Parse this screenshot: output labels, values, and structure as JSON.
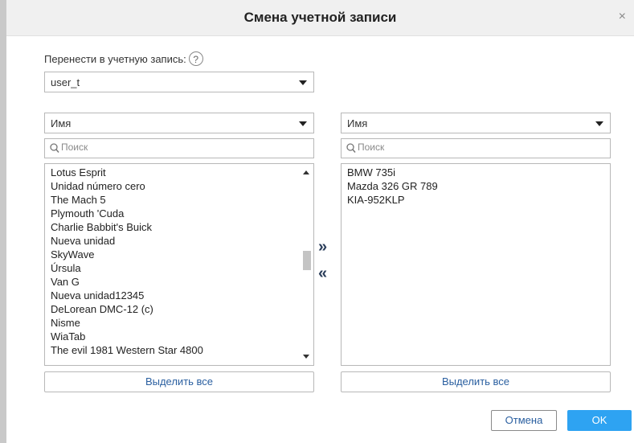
{
  "dialog": {
    "title": "Смена учетной записи",
    "close_glyph": "×"
  },
  "target": {
    "label": "Перенести в учетную запись:",
    "help_glyph": "?",
    "account_value": "user_t"
  },
  "left": {
    "sort_value": "Имя",
    "search_placeholder": "Поиск",
    "items": [
      "Lotus Esprit",
      "Unidad número cero",
      "The Mach 5",
      "Plymouth 'Cuda",
      "Charlie Babbit's Buick",
      "Nueva unidad",
      "SkyWave",
      "Úrsula",
      "Van G",
      "Nueva unidad12345",
      "DeLorean DMC-12 (c)",
      "Nisme",
      "WiaTab",
      "The evil 1981 Western Star 4800"
    ],
    "select_all_label": "Выделить все"
  },
  "right": {
    "sort_value": "Имя",
    "search_placeholder": "Поиск",
    "items": [
      "BMW 735i",
      "Mazda 326 GR 789",
      "KIA-952KLP"
    ],
    "select_all_label": "Выделить все"
  },
  "transfer": {
    "move_right_glyph": "»",
    "move_left_glyph": "«"
  },
  "footer": {
    "cancel_label": "Отмена",
    "ok_label": "OK"
  },
  "colors": {
    "ok_button": "#2ea3f2",
    "link_text": "#2a5fa0",
    "transfer_arrows": "#2a3d5a"
  }
}
